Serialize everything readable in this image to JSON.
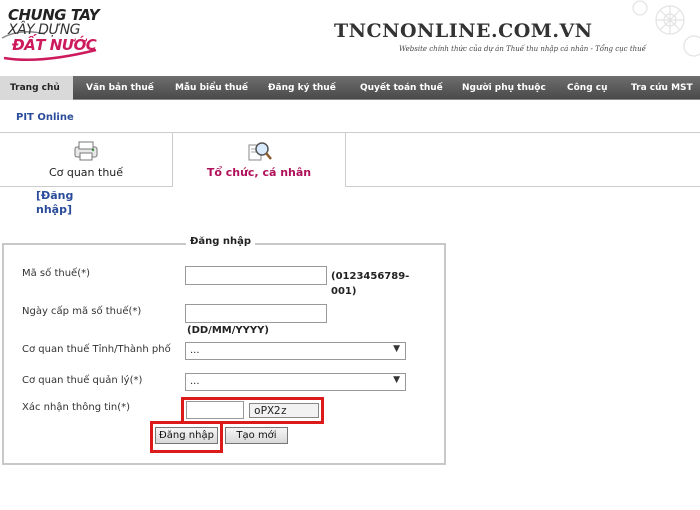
{
  "logo": {
    "line1": "CHUNG TAY",
    "line2": "XÂY DỰNG",
    "line3": "ĐẤT NƯỚC"
  },
  "site": {
    "title": "TNCNONLINE.COM.VN",
    "subtitle": "Website chính thức của dự án Thuế thu nhập cá nhân - Tổng cục thuế"
  },
  "nav": [
    {
      "label": "Trang chủ",
      "active": true
    },
    {
      "label": "Văn bản thuế"
    },
    {
      "label": "Mẫu biểu thuế"
    },
    {
      "label": "Đăng ký thuế"
    },
    {
      "label": "Quyết toán thuế"
    },
    {
      "label": "Người phụ thuộc"
    },
    {
      "label": "Công cụ"
    },
    {
      "label": "Tra cứu MST"
    }
  ],
  "breadcrumb": "PIT Online",
  "tabs": [
    {
      "label": "Cơ quan thuế",
      "icon": "tax-office-icon"
    },
    {
      "label": "Tổ chức, cá nhân",
      "icon": "organization-search-icon",
      "active": true
    }
  ],
  "login_link": "[Đăng nhập]",
  "form": {
    "legend": "Đăng nhập",
    "tax_code_label": "Mã số thuế(*)",
    "tax_code_value": "",
    "tax_code_hint": "(0123456789-001)",
    "issue_date_label": "Ngày cấp mã số thuế(*)",
    "issue_date_value": "",
    "issue_date_hint": "(DD/MM/YYYY)",
    "province_label": "Cơ quan thuế Tỉnh/Thành phố",
    "province_value": "...",
    "managing_label": "Cơ quan thuế quản lý(*)",
    "managing_value": "...",
    "captcha_label": "Xác nhận thông tin(*)",
    "captcha_value": "",
    "captcha_code": "oPX2z",
    "login_button": "Đăng nhập",
    "reset_button": "Tạo mới"
  },
  "colors": {
    "accent": "#cc1a5c",
    "highlight": "#dd1a1a",
    "link": "#2a4c9a"
  }
}
